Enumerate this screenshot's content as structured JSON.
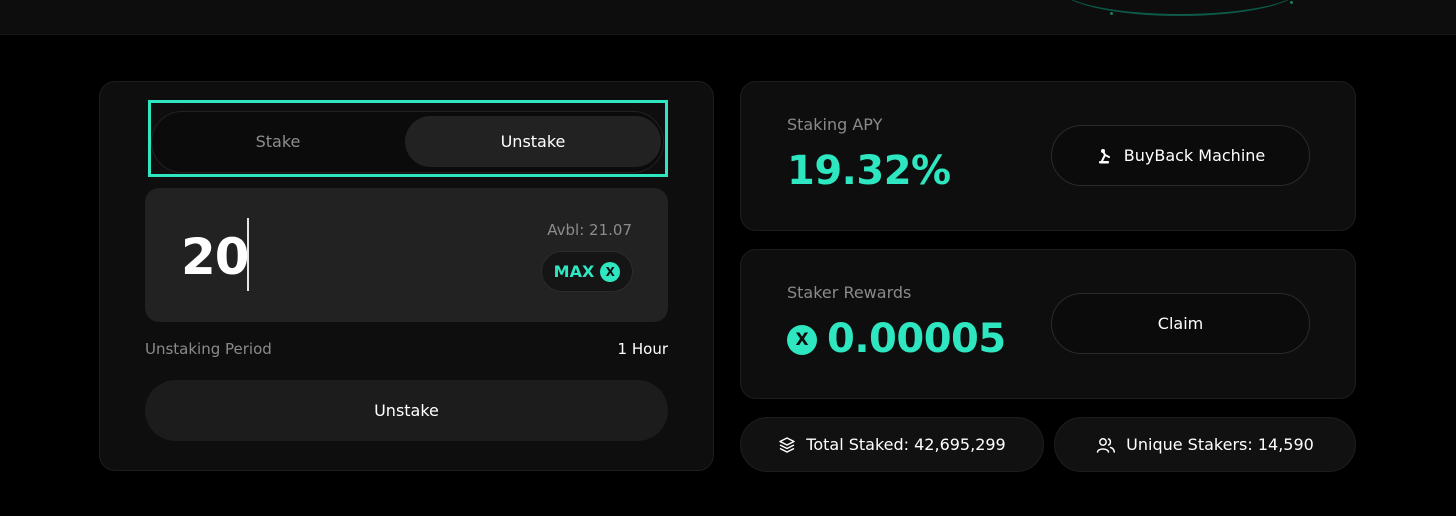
{
  "tabs": {
    "stake_label": "Stake",
    "unstake_label": "Unstake",
    "active": "Unstake"
  },
  "amount": {
    "value": "20",
    "available": "Avbl: 21.07",
    "max_label": "MAX",
    "token_symbol": "X"
  },
  "unstaking_period": {
    "label": "Unstaking Period",
    "value": "1 Hour"
  },
  "actions": {
    "unstake_button": "Unstake"
  },
  "apy": {
    "label": "Staking APY",
    "value": "19.32%",
    "buyback_label": "BuyBack Machine"
  },
  "rewards": {
    "label": "Staker Rewards",
    "value": "0.00005",
    "claim_label": "Claim",
    "token_symbol": "X"
  },
  "stats": {
    "total_staked": "Total Staked: 42,695,299",
    "unique_stakers": "Unique Stakers: 14,590"
  },
  "colors": {
    "accent": "#2ee6c0",
    "background": "#000000",
    "card": "#0e0e0e",
    "input": "#222222"
  },
  "icons": {
    "buyback": "robot-arm-icon",
    "total_staked": "stack-icon",
    "unique_stakers": "users-icon",
    "token": "x-token-icon"
  }
}
